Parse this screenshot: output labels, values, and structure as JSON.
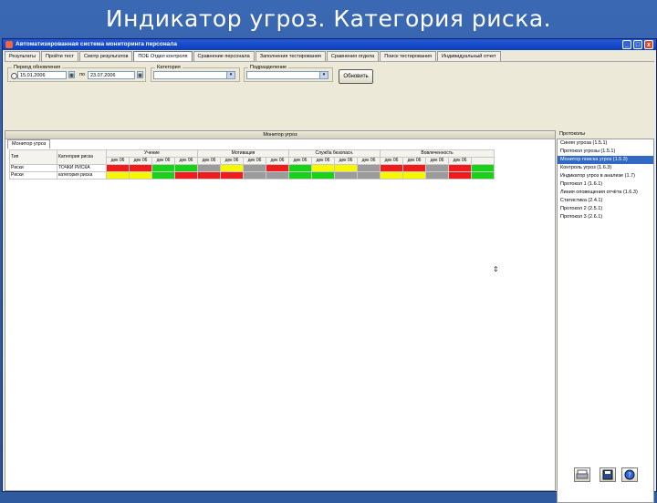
{
  "slide_title": "Индикатор угроз. Категория риска.",
  "window": {
    "title": "Автоматизированная система мониторинга персонала",
    "min": "_",
    "max": "□",
    "close": "x"
  },
  "tabs": [
    "Результаты",
    "Пройти тест",
    "Смотр результатов",
    "ПОЕ Отдел контроля",
    "Сравнение персонала",
    "Заполнения тестирования",
    "Сравнения отдела",
    "Поиск тестирования",
    "Индивидуальный отчет"
  ],
  "filters": {
    "period_label": "Период обновления",
    "date_from": "15.01.2006",
    "to_label": "по",
    "date_to": "23.07.2006",
    "category_label": "Категория",
    "category_value": "",
    "department_label": "Подразделение",
    "department_value": "",
    "refresh_button": "Обновить"
  },
  "panel": {
    "title": "Монитор угроз",
    "inner_tab": "Монитор угроз"
  },
  "grid": {
    "headers": [
      "Тип",
      "Категория риска"
    ],
    "groups": [
      "Учение",
      "Мотивация",
      "Служба безопасн.",
      "Вовлеченность"
    ],
    "subheaders": [
      "дек 06",
      "дек 06",
      "дек 06",
      "дек 06",
      "дек 06",
      "дек 06",
      "дек 06",
      "дек 06",
      "дек 06",
      "дек 06",
      "дек 06",
      "дек 06",
      "дек 06",
      "дек 06",
      "дек 06",
      "дек 06"
    ],
    "rows": [
      {
        "type": "Риски",
        "category": "ТОЧКИ РИСКА",
        "cells": [
          "red",
          "red",
          "green",
          "green",
          "gray",
          "yellow",
          "gray",
          "red",
          "green",
          "yellow",
          "yellow",
          "gray",
          "red",
          "red",
          "gray",
          "red",
          "green"
        ]
      },
      {
        "type": "Риски",
        "category": "категория риска",
        "cells": [
          "yellow",
          "yellow",
          "green",
          "red",
          "red",
          "red",
          "gray",
          "gray",
          "green",
          "green",
          "gray",
          "gray",
          "yellow",
          "yellow",
          "gray",
          "red",
          "green"
        ]
      }
    ]
  },
  "colors": {
    "red": "#ee1c1c",
    "green": "#19d119",
    "yellow": "#f7f700",
    "gray": "#9b9b9b",
    "selection": "#316ac5"
  },
  "sidebar": {
    "title": "Протоколы",
    "items": [
      "Синяя угроза (1.5.1)",
      "Протокол угрозы (1.5.1)",
      "Монитор поиска угроз (1.5.3)",
      "Контроль угроз (1.6.3)",
      "Индикатор угроз в анализе (1.7)",
      "Протокол 1 (1.6.1)",
      "Линия оповещения отчёта (1.6.3)",
      "Статистика (2.4.1)",
      "Протокол 2 (2.5.1)",
      "Протокол 3 (2.6.1)"
    ],
    "selected_index": 2
  },
  "toolbar": {
    "print_icon": "printer-icon",
    "save_icon": "save-icon",
    "help_icon": "help-icon"
  }
}
